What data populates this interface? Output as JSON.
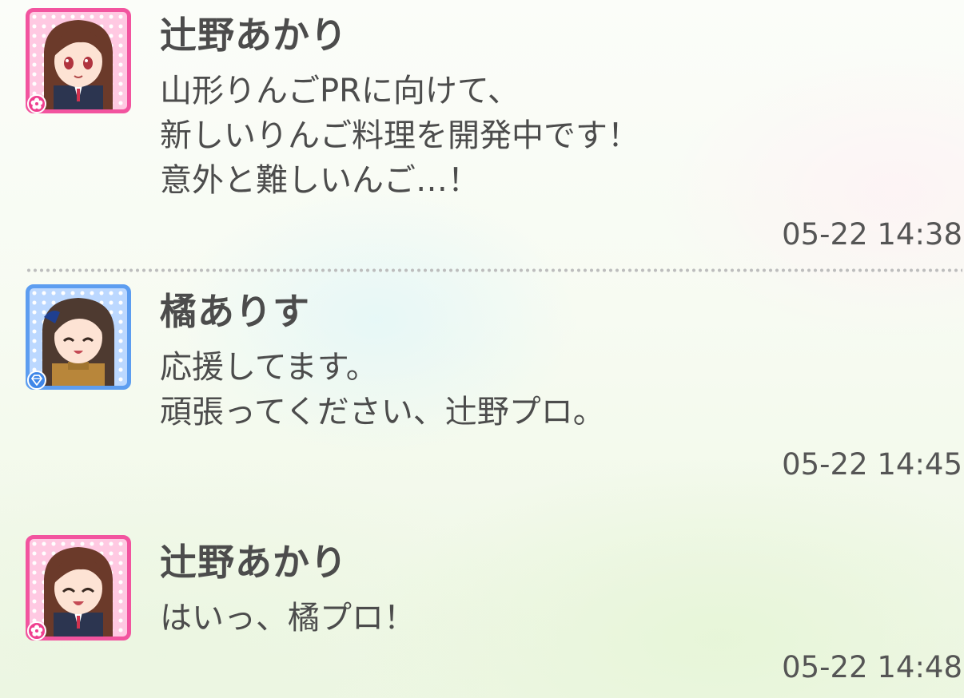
{
  "colors": {
    "accent_pink": "#f2549f",
    "accent_blue": "#5d9df0",
    "text": "#4c4c4c"
  },
  "messages": [
    {
      "sender": "辻野あかり",
      "avatar_icon": "girl-portrait-pink-icon",
      "badge_icon": "flower-icon",
      "lines": [
        "山形りんごPRに向けて、",
        "新しいりんご料理を開発中です！",
        "意外と難しいんご…！"
      ],
      "time": "05-22 14:38"
    },
    {
      "sender": "橘ありす",
      "avatar_icon": "girl-portrait-blue-icon",
      "badge_icon": "diamond-icon",
      "lines": [
        "応援してます。",
        "頑張ってください、辻野プロ。"
      ],
      "time": "05-22 14:45"
    },
    {
      "sender": "辻野あかり",
      "avatar_icon": "girl-portrait-pink-icon",
      "badge_icon": "flower-icon",
      "lines": [
        "はいっ、橘プロ！"
      ],
      "time": "05-22 14:48"
    }
  ]
}
